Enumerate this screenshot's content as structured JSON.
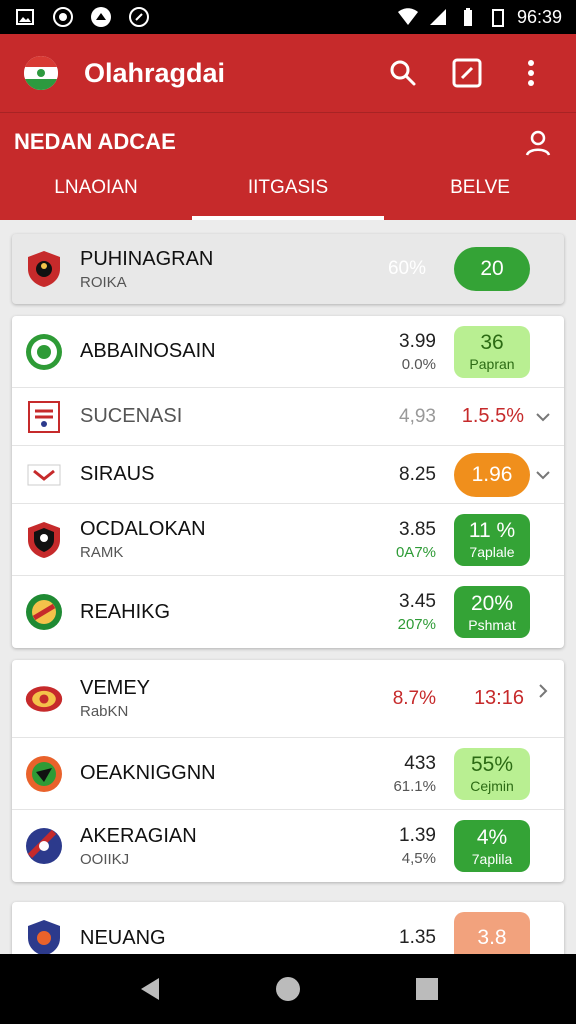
{
  "status": {
    "time": "96:39"
  },
  "app": {
    "title": "Olahragdai"
  },
  "header": {
    "title": "NEDAN ADCAE"
  },
  "tabs": [
    {
      "label": "LNAOIAN"
    },
    {
      "label": "IITGASIS"
    },
    {
      "label": "BELVE"
    }
  ],
  "list": {
    "featured": {
      "name": "PUHINAGRAN",
      "sub": "ROIKA",
      "pct": "60%",
      "value": "20"
    },
    "card1": [
      {
        "name": "ABBAINOSAIN",
        "val": "3.99",
        "subval": "0.0%",
        "pill_big": "36",
        "pill_small": "Papran"
      },
      {
        "name": "SUCENASI",
        "val": "4,93",
        "text": "1.5.5%"
      },
      {
        "name": "SIRAUS",
        "val": "8.25",
        "pill_big": "1.96"
      },
      {
        "name": "OCDALOKAN",
        "sub": "RAMK",
        "val": "3.85",
        "subval": "0A7%",
        "pill_big": "11 %",
        "pill_small": "7aplale"
      },
      {
        "name": "REAHIKG",
        "val": "3.45",
        "subval": "207%",
        "pill_big": "20%",
        "pill_small": "Pshmat"
      }
    ],
    "card2": [
      {
        "name": "VEMEY",
        "sub": "RabKN",
        "val": "8.7%",
        "text": "13:16"
      },
      {
        "name": "OEAKNIGGNN",
        "val": "433",
        "subval": "61.1%",
        "pill_big": "55%",
        "pill_small": "Cejmin"
      },
      {
        "name": "AKERAGIAN",
        "sub": "OOIIKJ",
        "val": "1.39",
        "subval": "4,5%",
        "pill_big": "4%",
        "pill_small": "7aplila"
      }
    ],
    "card3": [
      {
        "name": "NEUANG",
        "val": "1.35",
        "pill_big": "3.8"
      }
    ]
  },
  "colors": {
    "primary": "#c62a2b",
    "green": "#34a336",
    "light_green": "#b9ef92",
    "orange": "#f08f1c",
    "salmon": "#f2a27d"
  }
}
